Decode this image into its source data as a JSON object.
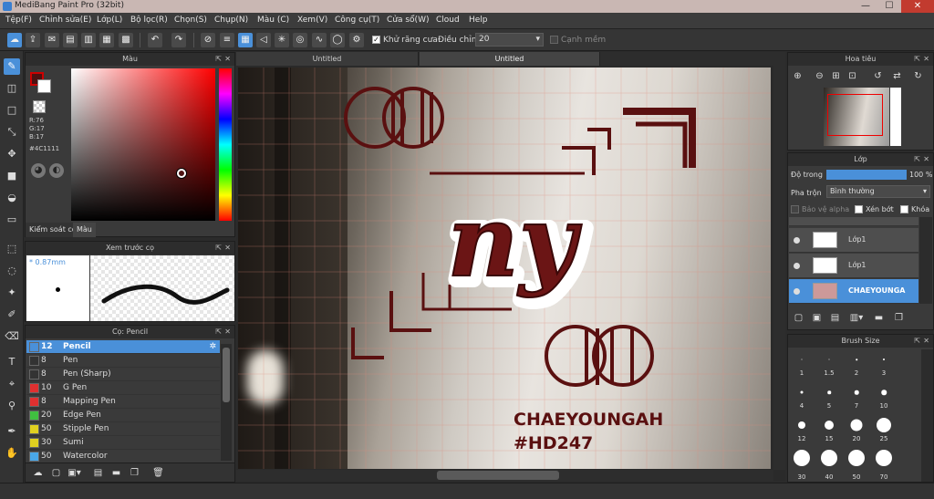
{
  "window": {
    "title": "MediBang Paint Pro (32bit)",
    "minimize": "—",
    "maximize": "☐",
    "close": "✕"
  },
  "menu": [
    "Tệp(F)",
    "Chỉnh sửa(E)",
    "Lớp(L)",
    "Bộ lọc(R)",
    "Chọn(S)",
    "Chụp(N)",
    "Màu (C)",
    "Xem(V)",
    "Công cụ(T)",
    "Cửa sổ(W)",
    "Cloud",
    "Help"
  ],
  "toolbar": {
    "antialias_label": "Khử răng cưa",
    "adjust_label": "Điều chỉnh",
    "adjust_value": "20",
    "smooth_label": "Cạnh mềm"
  },
  "color_panel": {
    "title": "Màu",
    "rgb": "R:76\nG:17\nB:17",
    "hex": "#4C1111",
    "tab_control": "Kiểm soát co",
    "tab_color": "Màu",
    "fg_color": "#4C1111"
  },
  "brush_preview": {
    "title": "Xem trước cọ",
    "size": "0.87mm"
  },
  "brush_panel": {
    "title": "Cọ: Pencil",
    "items": [
      {
        "size": "12",
        "name": "Pencil",
        "color": "#4a90d9"
      },
      {
        "size": "8",
        "name": "Pen",
        "color": "#333333"
      },
      {
        "size": "8",
        "name": "Pen (Sharp)",
        "color": "#333333"
      },
      {
        "size": "10",
        "name": "G Pen",
        "color": "#e03030"
      },
      {
        "size": "8",
        "name": "Mapping Pen",
        "color": "#e03030"
      },
      {
        "size": "20",
        "name": "Edge Pen",
        "color": "#40c040"
      },
      {
        "size": "50",
        "name": "Stipple Pen",
        "color": "#e0d020"
      },
      {
        "size": "30",
        "name": "Sumi",
        "color": "#e0d020"
      },
      {
        "size": "50",
        "name": "Watercolor",
        "color": "#4aa8e8"
      }
    ]
  },
  "canvas": {
    "tabs": [
      "Untitled",
      "Untitled"
    ],
    "artwork_text": {
      "script": "ny",
      "name": "CHAEYOUNGAH",
      "tag": "#HD247"
    }
  },
  "navigator": {
    "title": "Hoa tiêu"
  },
  "layer_panel": {
    "title": "Lớp",
    "opacity_label": "Độ trong",
    "opacity_value": "100 %",
    "blend_label": "Pha trộn",
    "blend_value": "Bình thường",
    "protect_alpha": "Bảo vệ alpha",
    "clip": "Xén bớt",
    "lock": "Khóa",
    "layers": [
      "Lớp1",
      "Lớp1",
      "CHAEYOUNGA"
    ]
  },
  "brush_size": {
    "title": "Brush Size",
    "sizes": [
      "1",
      "1.5",
      "2",
      "3",
      "4",
      "5",
      "7",
      "10",
      "12",
      "15",
      "20",
      "25",
      "30",
      "40",
      "50",
      "70"
    ]
  }
}
